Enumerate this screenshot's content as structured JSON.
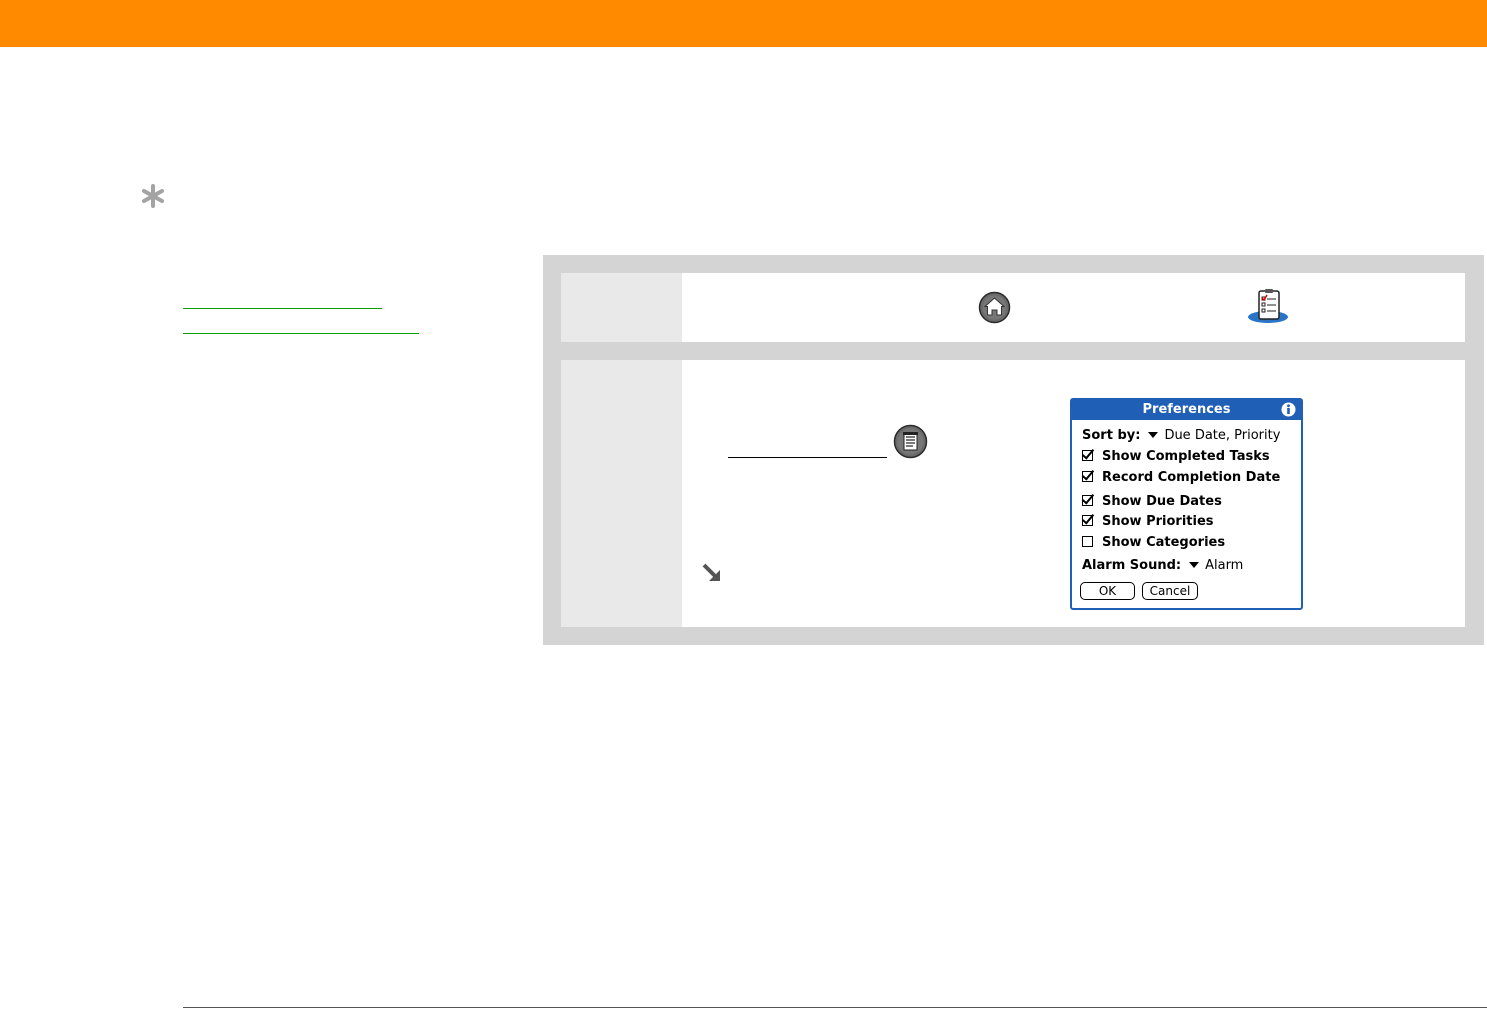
{
  "icons": {
    "tip": "asterisk-icon",
    "home": "home-icon",
    "tasks_app": "tasks-app-icon",
    "menu": "menu-icon",
    "continue": "arrow-down-right-icon",
    "info": "info-icon"
  },
  "colors": {
    "header": "#ff8a00",
    "link": "#0aa000",
    "dialog_accent": "#1f5fb5",
    "panel": "#d4d4d4"
  },
  "dialog": {
    "title": "Preferences",
    "sort_label": "Sort by:",
    "sort_value": "Due Date, Priority",
    "options": [
      {
        "label": "Show Completed Tasks",
        "checked": true
      },
      {
        "label": "Record Completion Date",
        "checked": true
      },
      {
        "label": "Show Due Dates",
        "checked": true
      },
      {
        "label": "Show Priorities",
        "checked": true
      },
      {
        "label": "Show Categories",
        "checked": false
      }
    ],
    "alarm_label": "Alarm Sound:",
    "alarm_value": "Alarm",
    "ok_label": "OK",
    "cancel_label": "Cancel"
  }
}
